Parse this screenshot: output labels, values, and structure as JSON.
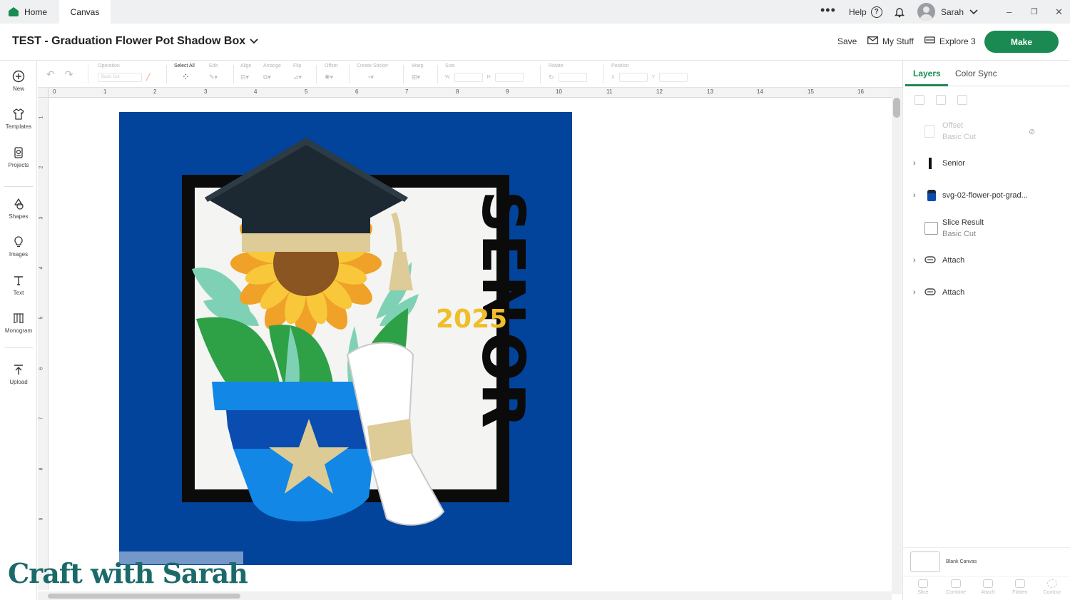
{
  "tabs": {
    "home": "Home",
    "canvas": "Canvas"
  },
  "topbar": {
    "more": "•••",
    "help": "Help",
    "help_glyph": "?",
    "user": "Sarah"
  },
  "window_controls": {
    "minimize": "–",
    "restore": "❐",
    "close": "✕"
  },
  "header": {
    "title": "TEST - Graduation Flower Pot Shadow Box",
    "save": "Save",
    "my_stuff": "My Stuff",
    "machine": "Explore 3",
    "make": "Make"
  },
  "sidebar": [
    {
      "label": "New",
      "icon": "plus-circle-icon"
    },
    {
      "label": "Templates",
      "icon": "shirt-icon"
    },
    {
      "label": "Projects",
      "icon": "projects-icon"
    },
    {
      "label": "Shapes",
      "icon": "shapes-icon"
    },
    {
      "label": "Images",
      "icon": "bulb-icon"
    },
    {
      "label": "Text",
      "icon": "text-icon"
    },
    {
      "label": "Monogram",
      "icon": "monogram-icon"
    },
    {
      "label": "Upload",
      "icon": "upload-icon"
    }
  ],
  "toolbar": {
    "operation": "Operation",
    "operation_value": "Basic Cut",
    "select_all": "Select All",
    "edit": "Edit",
    "align": "Align",
    "arrange": "Arrange",
    "flip": "Flip",
    "offset": "Offset",
    "create_sticker": "Create Sticker",
    "warp": "Warp",
    "size": "Size",
    "size_w": "W",
    "size_h": "H",
    "rotate": "Rotate",
    "position": "Position",
    "pos_x": "X",
    "pos_y": "Y"
  },
  "ruler": {
    "h_ticks": [
      "0",
      "1",
      "2",
      "3",
      "4",
      "5",
      "6",
      "7",
      "8",
      "9",
      "10",
      "11",
      "12",
      "13",
      "14",
      "15",
      "16"
    ],
    "v_ticks": [
      "1",
      "2",
      "3",
      "4",
      "5",
      "6",
      "7",
      "8",
      "9"
    ]
  },
  "design": {
    "text_top": "SEN",
    "text_bottom": "OR",
    "year": "2025",
    "colors": {
      "background": "#02449c",
      "frame": "#0b0b0b",
      "inner": "#f4f4f2",
      "cap": "#1d2932",
      "band": "#ddcb98",
      "petal_outer": "#f0a127",
      "petal_inner": "#f8c83a",
      "center": "#8a5520",
      "leaf_light": "#7fd1b5",
      "leaf_dark": "#2ea046",
      "pot_light": "#1287e6",
      "pot_dark": "#0a4cb0",
      "star": "#dccb95",
      "year": "#efbe28"
    }
  },
  "watermark": "Craft with Sarah",
  "layers_panel": {
    "tab_layers": "Layers",
    "tab_color_sync": "Color Sync",
    "items": [
      {
        "name": "Offset",
        "sub": "Basic Cut",
        "dim": true
      },
      {
        "name": "Senior",
        "sub": ""
      },
      {
        "name": "svg-02-flower-pot-grad...",
        "sub": ""
      },
      {
        "name": "Slice Result",
        "sub": "Basic Cut"
      },
      {
        "name": "Attach",
        "sub": ""
      },
      {
        "name": "Attach",
        "sub": ""
      }
    ],
    "blank_canvas": "Blank Canvas",
    "bottom_tools": [
      "Slice",
      "Combine",
      "Attach",
      "Flatten",
      "Contour"
    ]
  }
}
